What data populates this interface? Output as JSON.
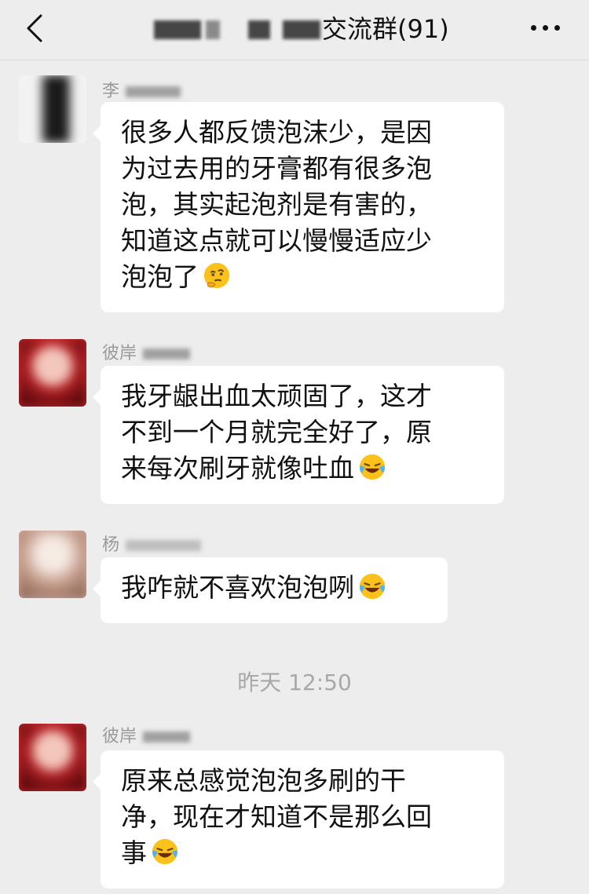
{
  "header": {
    "back_label": "back",
    "title": "交流群(91)",
    "more_label": "more"
  },
  "messages": [
    {
      "sender": "李",
      "lines": [
        "很多人都反馈泡沫少，是因",
        "为过去用的牙膏都有很多泡",
        "泡，其实起泡剂是有害的，",
        "知道这点就可以慢慢适应少",
        "泡泡了"
      ],
      "emoji": "thinking-face-emoji"
    },
    {
      "sender": "彼岸",
      "lines": [
        "我牙龈出血太顽固了，这才",
        "不到一个月就完全好了，原",
        "来每次刷牙就像吐血"
      ],
      "emoji": "crying-laughing-emoji"
    },
    {
      "sender": "杨",
      "lines": [
        "我咋就不喜欢泡泡咧"
      ],
      "emoji": "crying-laughing-emoji"
    },
    {
      "sender": "彼岸",
      "lines": [
        "原来总感觉泡泡多刷的干",
        "净，现在才知道不是那么回",
        "事"
      ],
      "emoji": "crying-laughing-emoji"
    }
  ],
  "timestamp": "昨天 12:50",
  "colors": {
    "background": "#ededed",
    "bubble": "#ffffff",
    "text": "#111111",
    "meta": "#a8a8a8"
  }
}
